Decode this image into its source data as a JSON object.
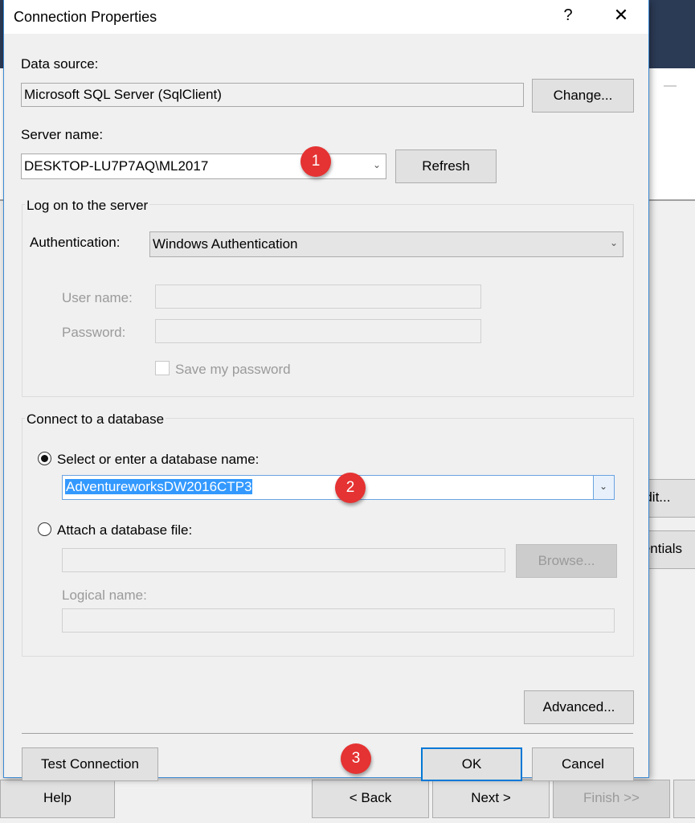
{
  "dialog": {
    "title": "Connection Properties",
    "help_glyph": "?",
    "close_glyph": "✕"
  },
  "data_source": {
    "label": "Data source:",
    "value": "Microsoft SQL Server (SqlClient)",
    "change_button": "Change..."
  },
  "server": {
    "label": "Server name:",
    "value": "DESKTOP-LU7P7AQ\\ML2017",
    "refresh_button": "Refresh"
  },
  "logon": {
    "group_title": "Log on to the server",
    "auth_label": "Authentication:",
    "auth_value": "Windows Authentication",
    "username_label": "User name:",
    "username_value": "",
    "password_label": "Password:",
    "password_value": "",
    "save_password_label": "Save my password",
    "save_password_checked": false
  },
  "database": {
    "group_title": "Connect to a database",
    "select_option_label": "Select or enter a database name:",
    "select_option_checked": true,
    "database_name": "AdventureworksDW2016CTP3",
    "attach_option_label": "Attach a database file:",
    "attach_option_checked": false,
    "attach_file_value": "",
    "browse_button": "Browse...",
    "logical_name_label": "Logical name:",
    "logical_name_value": ""
  },
  "footer": {
    "advanced_button": "Advanced...",
    "test_connection_button": "Test Connection",
    "ok_button": "OK",
    "cancel_button": "Cancel"
  },
  "annotations": {
    "badge_1": "1",
    "badge_2": "2",
    "badge_3": "3",
    "badge_color": "#e53232"
  },
  "background_window": {
    "edit_button": "Edit...",
    "credentials_button": "Credentials",
    "help_button": "Help",
    "back_button": "< Back",
    "next_button": "Next >",
    "finish_button": "Finish >>"
  },
  "colors": {
    "accent": "#0078d7",
    "selection": "#3399ff",
    "header_dark": "#2b3a55"
  }
}
